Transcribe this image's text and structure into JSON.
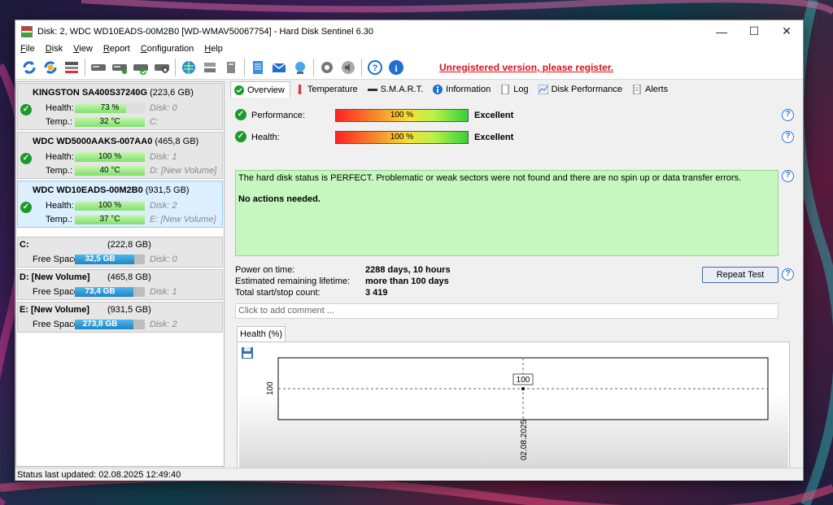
{
  "window": {
    "title": "Disk: 2, WDC WD10EADS-00M2B0 [WD-WMAV50067754]  -  Hard Disk Sentinel 6.30",
    "minimize": "—",
    "maximize": "☐",
    "close": "✕"
  },
  "menu": [
    {
      "label_u": "F",
      "label_rest": "ile"
    },
    {
      "label_u": "D",
      "label_rest": "isk"
    },
    {
      "label_u": "V",
      "label_rest": "iew"
    },
    {
      "label_u": "R",
      "label_rest": "eport"
    },
    {
      "label_u": "C",
      "label_rest": "onfiguration"
    },
    {
      "label_u": "H",
      "label_rest": "elp"
    }
  ],
  "toolbar": {
    "unregistered": "Unregistered version, please register."
  },
  "disks": [
    {
      "name": "KINGSTON SA400S37240G",
      "capacity": "(223,6 GB)",
      "health_label": "Health:",
      "health": "73 %",
      "health_pct": 73,
      "temp_label": "Temp.:",
      "temp": "32 °C",
      "disk_no": "Disk: 0",
      "volume": "C:"
    },
    {
      "name": "WDC WD5000AAKS-007AA0",
      "capacity": "(465,8 GB)",
      "health_label": "Health:",
      "health": "100 %",
      "health_pct": 100,
      "temp_label": "Temp.:",
      "temp": "40 °C",
      "disk_no": "Disk: 1",
      "volume": "D: [New Volume]"
    },
    {
      "name": "WDC WD10EADS-00M2B0",
      "capacity": "(931,5 GB)",
      "health_label": "Health:",
      "health": "100 %",
      "health_pct": 100,
      "temp_label": "Temp.:",
      "temp": "37 °C",
      "disk_no": "Disk: 2",
      "volume": "E: [New Volume]"
    }
  ],
  "volumes": [
    {
      "name": "C:",
      "capacity": "(222,8 GB)",
      "free_label": "Free Space",
      "free": "32,5 GB",
      "free_pct": 14.6,
      "disk_no": "Disk: 0"
    },
    {
      "name": "D: [New Volume]",
      "capacity": "(465,8 GB)",
      "free_label": "Free Space",
      "free": "73,4 GB",
      "free_pct": 15.8,
      "disk_no": "Disk: 1"
    },
    {
      "name": "E: [New Volume]",
      "capacity": "(931,5 GB)",
      "free_label": "Free Space",
      "free": "273,8 GB",
      "free_pct": 29.4,
      "disk_no": "Disk: 2"
    }
  ],
  "tabs": [
    "Overview",
    "Temperature",
    "S.M.A.R.T.",
    "Information",
    "Log",
    "Disk Performance",
    "Alerts"
  ],
  "overview": {
    "performance_label": "Performance:",
    "performance_value": "100 %",
    "performance_verdict": "Excellent",
    "health_label": "Health:",
    "health_value": "100 %",
    "health_verdict": "Excellent",
    "message_1": "The hard disk status is PERFECT. Problematic or weak sectors were not found and there are no spin up or data transfer errors.",
    "message_2": "No actions needed.",
    "power_on_label": "Power on time:",
    "power_on_value": "2288 days, 10 hours",
    "lifetime_label": "Estimated remaining lifetime:",
    "lifetime_value": "more than 100 days",
    "startstop_label": "Total start/stop count:",
    "startstop_value": "3 419",
    "repeat_test": "Repeat Test",
    "comment_placeholder": "Click to add comment ...",
    "chart_tab": "Health (%)"
  },
  "chart_data": {
    "type": "line",
    "x": [
      "02.08.2025"
    ],
    "series": [
      {
        "values": [
          100
        ]
      }
    ],
    "point_label": "100",
    "y_tick": "100",
    "x_tick": "02.08.2025"
  },
  "status": "Status last updated: 02.08.2025 12:49:40",
  "colors": {
    "accent_green": "#1a9a2a",
    "message_bg": "#c6f7bf",
    "unregistered": "#e0101a"
  }
}
